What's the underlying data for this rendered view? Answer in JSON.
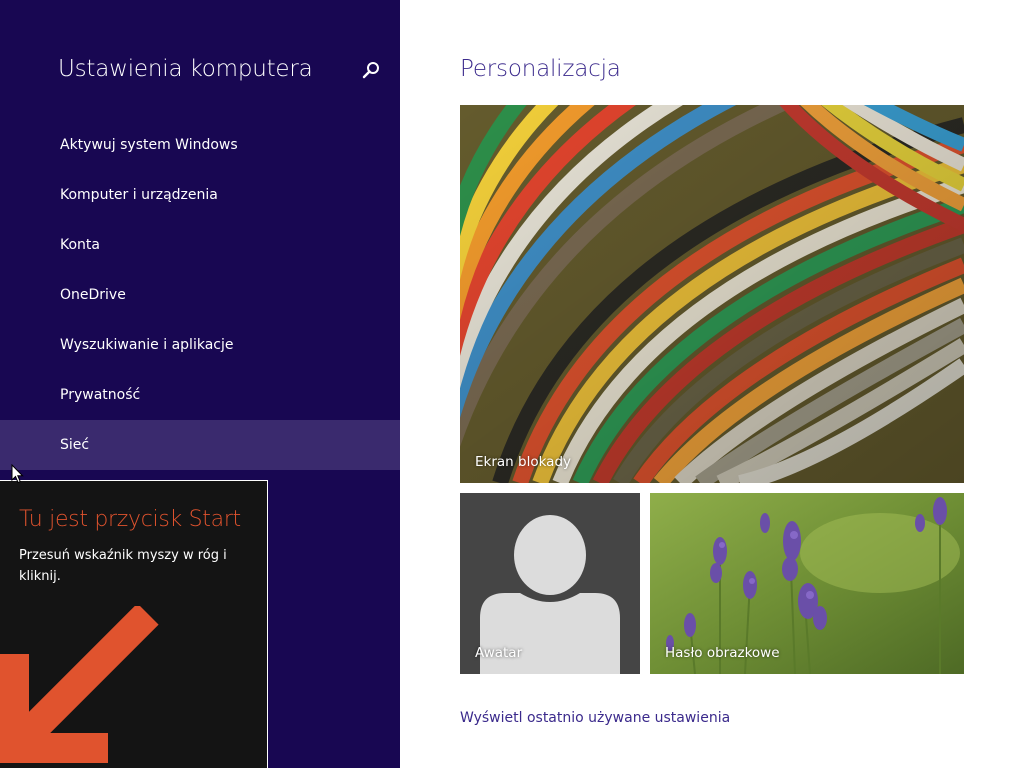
{
  "sidebar": {
    "title": "Ustawienia komputera",
    "search_icon": "search-icon",
    "items": [
      {
        "label": "Aktywuj system Windows"
      },
      {
        "label": "Komputer i urządzenia"
      },
      {
        "label": "Konta"
      },
      {
        "label": "OneDrive"
      },
      {
        "label": "Wyszukiwanie i aplikacje"
      },
      {
        "label": "Prywatność"
      },
      {
        "label": "Sieć"
      }
    ],
    "selected_item": "Sieć"
  },
  "tip": {
    "title": "Tu jest przycisk Start",
    "text": "Przesuń wskaźnik myszy w róg i kliknij.",
    "arrow_icon": "arrow-down-left-icon"
  },
  "main": {
    "title": "Personalizacja",
    "tiles": {
      "lock_screen": "Ekran blokady",
      "avatar": "Awatar",
      "picture_password": "Hasło obrazkowe"
    },
    "recent_link": "Wyświetl ostatnio używane ustawienia"
  },
  "colors": {
    "sidebar_bg": "#180752",
    "selected_bg": "#3a2a6e",
    "accent_title": "#3b2a8c",
    "tip_title": "#e0532e",
    "tip_bg": "#141414"
  }
}
